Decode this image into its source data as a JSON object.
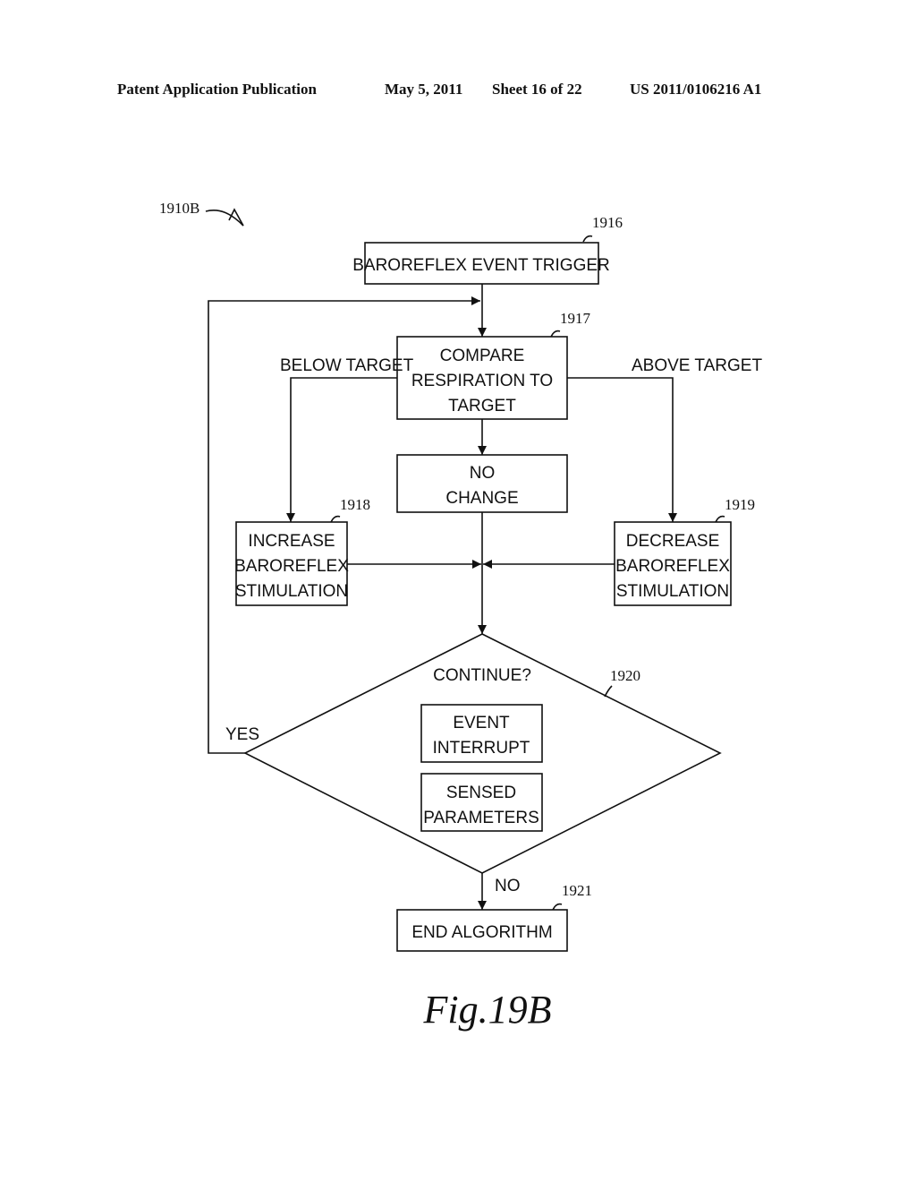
{
  "header": {
    "publication": "Patent Application Publication",
    "date": "May 5, 2011",
    "sheet": "Sheet 16 of 22",
    "number": "US 2011/0106216 A1"
  },
  "diagram": {
    "figure_ref": "1910B",
    "figure_caption": "Fig.19B",
    "nodes": {
      "trigger": {
        "ref": "1916",
        "lines": [
          "BAROREFLEX EVENT TRIGGER"
        ]
      },
      "compare": {
        "ref": "1917",
        "lines": [
          "COMPARE",
          "RESPIRATION TO",
          "TARGET"
        ]
      },
      "no_change": {
        "lines": [
          "NO",
          "CHANGE"
        ]
      },
      "increase": {
        "ref": "1918",
        "lines": [
          "INCREASE",
          "BAROREFLEX",
          "STIMULATION"
        ]
      },
      "decrease": {
        "ref": "1919",
        "lines": [
          "DECREASE",
          "BAROREFLEX",
          "STIMULATION"
        ]
      },
      "continue": {
        "ref": "1920",
        "question": "CONTINUE?"
      },
      "event_interrupt": {
        "lines": [
          "EVENT",
          "INTERRUPT"
        ]
      },
      "sensed_parameters": {
        "lines": [
          "SENSED",
          "PARAMETERS"
        ]
      },
      "end": {
        "ref": "1921",
        "lines": [
          "END ALGORITHM"
        ]
      }
    },
    "edge_labels": {
      "below": "BELOW TARGET",
      "above": "ABOVE TARGET",
      "yes": "YES",
      "no": "NO"
    }
  }
}
